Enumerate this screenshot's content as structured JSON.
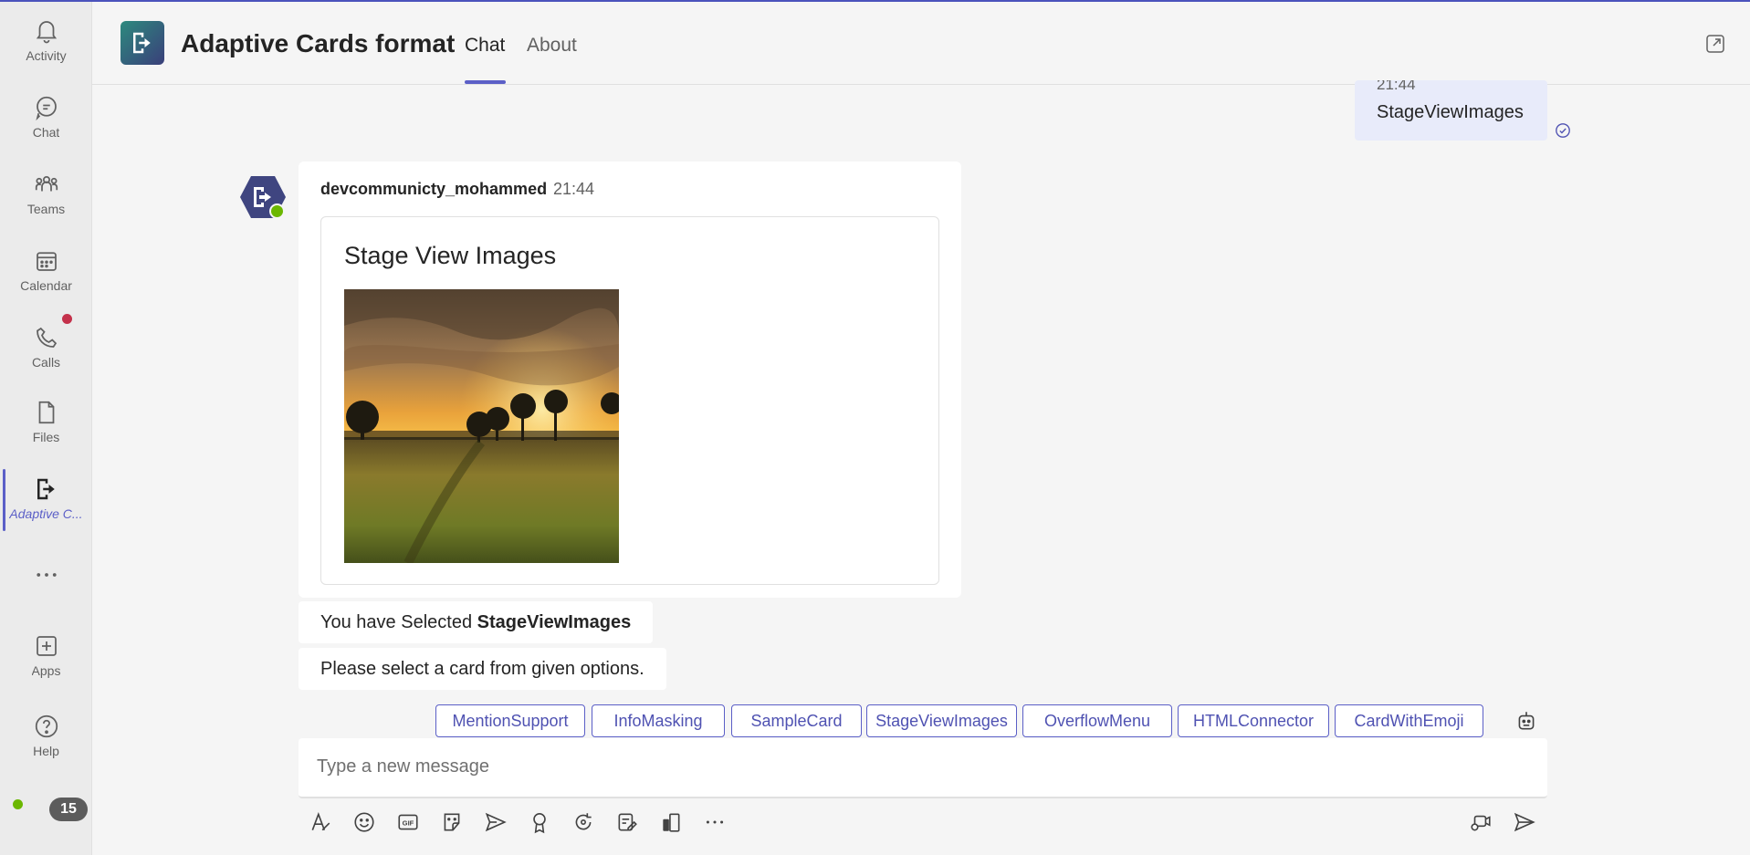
{
  "rail": {
    "items": [
      {
        "label": "Activity",
        "icon": "bell-icon"
      },
      {
        "label": "Chat",
        "icon": "chat-icon"
      },
      {
        "label": "Teams",
        "icon": "teams-icon"
      },
      {
        "label": "Calendar",
        "icon": "calendar-icon"
      },
      {
        "label": "Calls",
        "icon": "phone-icon"
      },
      {
        "label": "Files",
        "icon": "file-icon"
      },
      {
        "label": "Adaptive C...",
        "icon": "app-exit-icon"
      },
      {
        "label": "",
        "icon": "more-icon"
      },
      {
        "label": "Apps",
        "icon": "add-app-icon"
      },
      {
        "label": "Help",
        "icon": "help-icon"
      }
    ],
    "notification_count": "15"
  },
  "header": {
    "title": "Adaptive Cards format",
    "tabs": [
      {
        "label": "Chat"
      },
      {
        "label": "About"
      }
    ]
  },
  "sent_message": {
    "time": "21:44",
    "text": "StageViewImages"
  },
  "bot_message": {
    "sender": "devcommunicty_mohammed",
    "time": "21:44",
    "card_title": "Stage View Images",
    "image_alt": "sunset landscape photo"
  },
  "followups": {
    "selected_prefix": "You have Selected ",
    "selected_value": "StageViewImages",
    "prompt": "Please select a card from given options."
  },
  "suggested_actions": [
    "MentionSupport",
    "InfoMasking",
    "SampleCard",
    "StageViewImages",
    "OverflowMenu",
    "HTMLConnector",
    "CardWithEmoji"
  ],
  "compose": {
    "placeholder": "Type a new message"
  },
  "colors": {
    "accent": "#5b5fc7",
    "presence": "#6bb700",
    "sent_bubble": "#e8ebfa"
  }
}
